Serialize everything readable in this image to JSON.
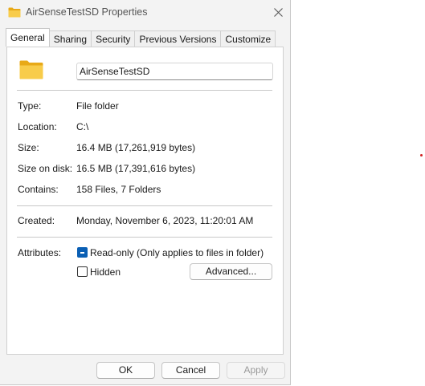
{
  "window": {
    "title": "AirSenseTestSD Properties",
    "close_icon": "close-icon"
  },
  "tabs": [
    {
      "label": "General",
      "active": true
    },
    {
      "label": "Sharing",
      "active": false
    },
    {
      "label": "Security",
      "active": false
    },
    {
      "label": "Previous Versions",
      "active": false
    },
    {
      "label": "Customize",
      "active": false
    }
  ],
  "general": {
    "folder_name": "AirSenseTestSD",
    "type_label": "Type:",
    "type_value": "File folder",
    "location_label": "Location:",
    "location_value": "C:\\",
    "size_label": "Size:",
    "size_value": "16.4 MB (17,261,919 bytes)",
    "size_on_disk_label": "Size on disk:",
    "size_on_disk_value": "16.5 MB (17,391,616 bytes)",
    "contains_label": "Contains:",
    "contains_value": "158 Files, 7 Folders",
    "created_label": "Created:",
    "created_value": "Monday, November 6, 2023, 11:20:01 AM",
    "attributes_label": "Attributes:",
    "readonly_label": "Read-only (Only applies to files in folder)",
    "readonly_state": "indeterminate",
    "hidden_label": "Hidden",
    "hidden_state": "unchecked",
    "advanced_label": "Advanced..."
  },
  "buttons": {
    "ok": "OK",
    "cancel": "Cancel",
    "apply": "Apply",
    "apply_enabled": false
  },
  "colors": {
    "accent": "#0a5fb4",
    "folder": "#f5c33b",
    "marker": "#d02020"
  }
}
